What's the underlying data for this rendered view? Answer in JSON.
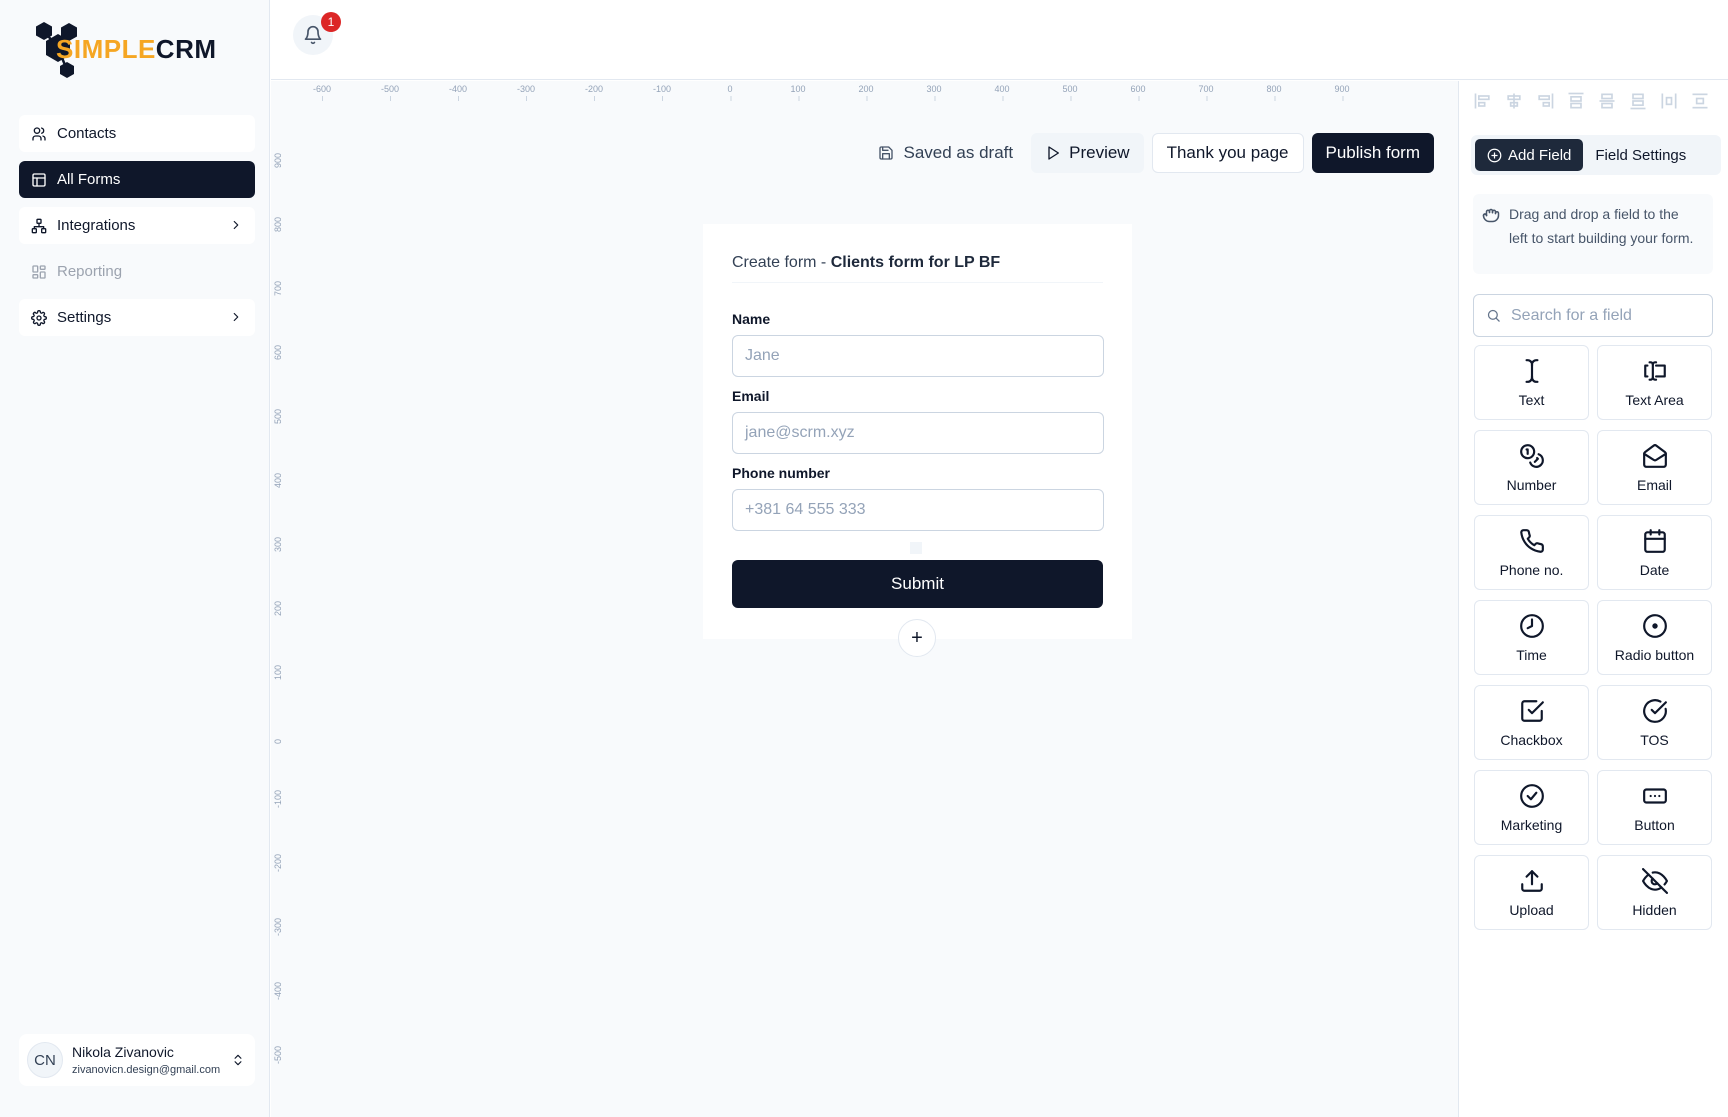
{
  "logo": {
    "prefix": "S",
    "simple_rest": "IMPLE",
    "crm": "CRM"
  },
  "sidebar": {
    "items": [
      {
        "label": "Contacts",
        "icon": "users-icon"
      },
      {
        "label": "All Forms",
        "icon": "table-icon"
      },
      {
        "label": "Integrations",
        "icon": "network-icon"
      },
      {
        "label": "Reporting",
        "icon": "grid-icon"
      },
      {
        "label": "Settings",
        "icon": "gear-icon"
      }
    ]
  },
  "user": {
    "initials": "CN",
    "name": "Nikola Zivanovic",
    "email": "zivanovicn.design@gmail.com"
  },
  "notifications": {
    "count": "1"
  },
  "rulers": {
    "horizontal": [
      "-600",
      "-500",
      "-400",
      "-300",
      "-200",
      "-100",
      "0",
      "100",
      "200",
      "300",
      "400",
      "500",
      "600",
      "700",
      "800",
      "900"
    ],
    "vertical": [
      "900",
      "800",
      "700",
      "600",
      "500",
      "400",
      "300",
      "200",
      "100",
      "0",
      "-100",
      "-200",
      "-300",
      "-400",
      "-500"
    ]
  },
  "toolbar": {
    "saved_status": "Saved as draft",
    "preview_label": "Preview",
    "thank_you_label": "Thank you page",
    "publish_label": "Publish form"
  },
  "form": {
    "title_prefix": "Create form - ",
    "title_name": "Clients form for LP BF",
    "fields": [
      {
        "label": "Name",
        "placeholder": "Jane"
      },
      {
        "label": "Email",
        "placeholder": "jane@scrm.xyz"
      },
      {
        "label": "Phone number",
        "placeholder": "+381 64 555 333"
      }
    ],
    "submit_label": "Submit",
    "add_label": "+"
  },
  "panel": {
    "tabs": {
      "add_field": "Add Field",
      "field_settings": "Field Settings"
    },
    "hint": "Drag and drop a field to the left to start building your form.",
    "search_placeholder": "Search for a field",
    "field_types": [
      {
        "label": "Text",
        "icon": "text-cursor-icon"
      },
      {
        "label": "Text Area",
        "icon": "text-area-icon"
      },
      {
        "label": "Number",
        "icon": "number-icon"
      },
      {
        "label": "Email",
        "icon": "mail-icon"
      },
      {
        "label": "Phone no.",
        "icon": "phone-icon"
      },
      {
        "label": "Date",
        "icon": "calendar-icon"
      },
      {
        "label": "Time",
        "icon": "clock-icon"
      },
      {
        "label": "Radio button",
        "icon": "radio-icon"
      },
      {
        "label": "Chackbox",
        "icon": "checkbox-icon"
      },
      {
        "label": "TOS",
        "icon": "check-circle-icon"
      },
      {
        "label": "Marketing",
        "icon": "check-circle-icon"
      },
      {
        "label": "Button",
        "icon": "button-icon"
      },
      {
        "label": "Upload",
        "icon": "upload-icon"
      },
      {
        "label": "Hidden",
        "icon": "eye-off-icon"
      }
    ]
  },
  "colors": {
    "primary": "#0f172a",
    "accent": "#f5a623",
    "badge": "#dc2626"
  }
}
